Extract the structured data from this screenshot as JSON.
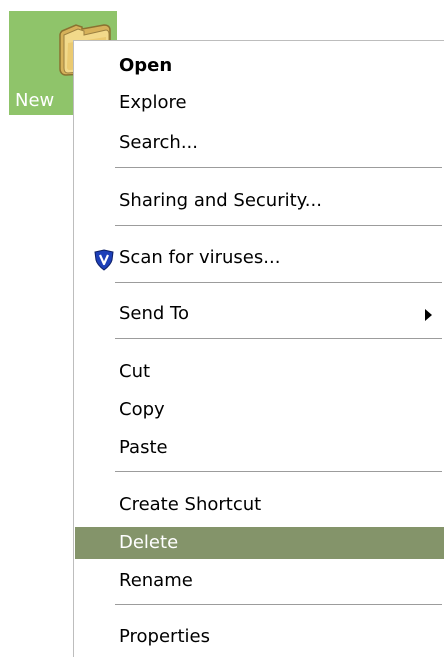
{
  "desktop": {
    "folder_label": "New"
  },
  "context_menu": {
    "open": "Open",
    "explore": "Explore",
    "search": "Search...",
    "sharing": "Sharing and Security...",
    "scan": "Scan for viruses...",
    "send_to": "Send To",
    "cut": "Cut",
    "copy": "Copy",
    "paste": "Paste",
    "create_shortcut": "Create Shortcut",
    "delete": "Delete",
    "rename": "Rename",
    "properties": "Properties",
    "highlighted_item": "Delete",
    "scan_icon": "shield-icon",
    "send_to_icon": "submenu-arrow-icon"
  },
  "colors": {
    "selection_background": "#84946a",
    "desktop_icon_highlight": "#8fc46a",
    "shield_blue": "#1d3fb8"
  }
}
